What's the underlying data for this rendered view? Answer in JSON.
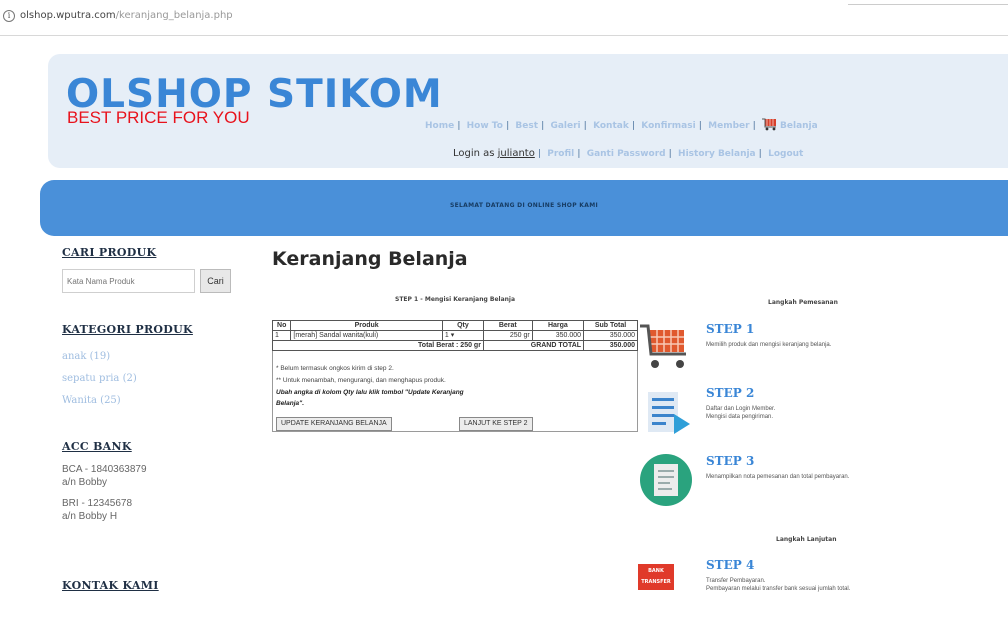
{
  "browser": {
    "url_domain": "olshop.wputra.com",
    "url_path": "/keranjang_belanja.php"
  },
  "header": {
    "logo_title": "OLSHOP STIKOM",
    "logo_subtitle": "BEST PRICE FOR YOU",
    "nav": [
      "Home",
      "How To",
      "Best",
      "Galeri",
      "Kontak",
      "Konfirmasi",
      "Member"
    ],
    "cart_label": "Belanja",
    "login_prefix": "Login as",
    "login_user": "julianto",
    "subnav": [
      "Profil",
      "Ganti Password",
      "History Belanja",
      "Logout"
    ]
  },
  "banner": {
    "text": "SELAMAT DATANG DI ONLINE SHOP KAMI"
  },
  "sidebar": {
    "search_heading": "CARI PRODUK",
    "search_placeholder": "Kata Nama Produk",
    "search_button": "Cari",
    "category_heading": "KATEGORI PRODUK",
    "categories": [
      "anak (19)",
      "sepatu pria (2)",
      "Wanita (25)"
    ],
    "bank_heading": "ACC BANK",
    "banks": [
      {
        "line1": "BCA - 1840363879",
        "line2": "a/n Bobby"
      },
      {
        "line1": "BRI - 12345678",
        "line2": "a/n Bobby H"
      }
    ],
    "contact_heading": "KONTAK KAMI"
  },
  "main": {
    "title": "Keranjang Belanja",
    "step_caption": "STEP 1 - Mengisi Keranjang Belanja",
    "table": {
      "headers": [
        "No",
        "Produk",
        "Qty",
        "Berat",
        "Harga",
        "Sub Total"
      ],
      "rows": [
        {
          "no": "1",
          "produk": "[merah] Sandal wanita(kuli)",
          "qty": "1",
          "berat": "250 gr",
          "harga": "350.000",
          "subtotal": "350.000"
        }
      ],
      "total_berat_label": "Total Berat : 250 gr",
      "grand_total_label": "GRAND TOTAL",
      "grand_total_value": "350.000"
    },
    "notes": [
      "* Belum termasuk ongkos kirim di step 2.",
      "** Untuk menambah, mengurangi, dan menghapus produk.",
      "Ubah angka di kolom Qty lalu klik tombol \"Update Keranjang",
      "Belanja\"."
    ],
    "update_button": "UPDATE KERANJANG BELANJA",
    "next_button": "LANJUT KE STEP 2"
  },
  "steps_panel": {
    "heading": "Langkah Pemesanan",
    "heading2": "Langkah Lanjutan",
    "steps": [
      {
        "title": "STEP 1",
        "line1": "Memilih produk dan mengisi keranjang belanja.",
        "line2": ""
      },
      {
        "title": "STEP 2",
        "line1": "Daftar dan Login Member.",
        "line2": "Mengisi data pengiriman."
      },
      {
        "title": "STEP 3",
        "line1": "Menampilkan nota pemesanan dan total pembayaran.",
        "line2": ""
      },
      {
        "title": "STEP 4",
        "line1": "Transfer Pembayaran.",
        "line2": "Pembayaran melalui transfer bank sesuai jumlah total."
      }
    ],
    "bank_transfer_label": "BANK TRANSFER"
  }
}
